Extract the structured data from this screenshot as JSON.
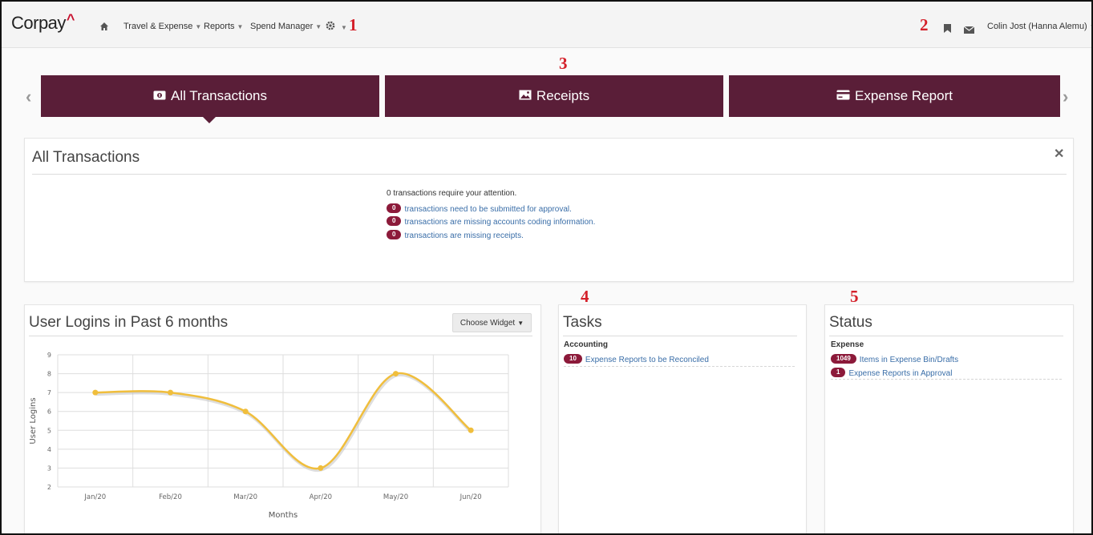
{
  "nav": {
    "logo": "Corpay",
    "items": [
      {
        "label": "Travel & Expense"
      },
      {
        "label": "Reports"
      },
      {
        "label": "Spend Manager"
      }
    ],
    "user": "Colin Jost (Hanna Alemu)"
  },
  "annotations": [
    "1",
    "2",
    "3",
    "4",
    "5"
  ],
  "tabs": [
    {
      "label": "All Transactions",
      "icon": "money-icon",
      "active": true
    },
    {
      "label": "Receipts",
      "icon": "image-icon"
    },
    {
      "label": "Expense Report",
      "icon": "credit-card-icon"
    }
  ],
  "transactions_panel": {
    "title": "All Transactions",
    "summary": "0 transactions require your attention.",
    "items": [
      {
        "count": "0",
        "text": "transactions need to be submitted for approval."
      },
      {
        "count": "0",
        "text": "transactions are missing accounts coding information."
      },
      {
        "count": "0",
        "text": "transactions are missing receipts."
      }
    ]
  },
  "logins_panel": {
    "title": "User Logins in Past 6 months",
    "widget_button": "Choose Widget"
  },
  "tasks_panel": {
    "title": "Tasks",
    "group": "Accounting",
    "items": [
      {
        "count": "10",
        "text": "Expense Reports to be Reconciled"
      }
    ]
  },
  "status_panel": {
    "title": "Status",
    "group": "Expense",
    "items": [
      {
        "count": "1049",
        "text": "Items in Expense Bin/Drafts"
      },
      {
        "count": "1",
        "text": "Expense Reports in Approval"
      }
    ]
  },
  "colors": {
    "tab_bg": "#5a1e38",
    "badge": "#8c1a3a",
    "line": "#f0be3c",
    "link": "#3a6ea8",
    "annotation": "#d4202a"
  },
  "chart_data": {
    "type": "line",
    "categories": [
      "Jan/20",
      "Feb/20",
      "Mar/20",
      "Apr/20",
      "May/20",
      "Jun/20"
    ],
    "values": [
      7,
      7,
      6,
      3,
      8,
      5
    ],
    "xlabel": "Months",
    "ylabel": "User Logins",
    "ylim": [
      2,
      9
    ],
    "yticks": [
      2,
      3,
      4,
      5,
      6,
      7,
      8,
      9
    ],
    "grid": true,
    "smooth": true
  }
}
